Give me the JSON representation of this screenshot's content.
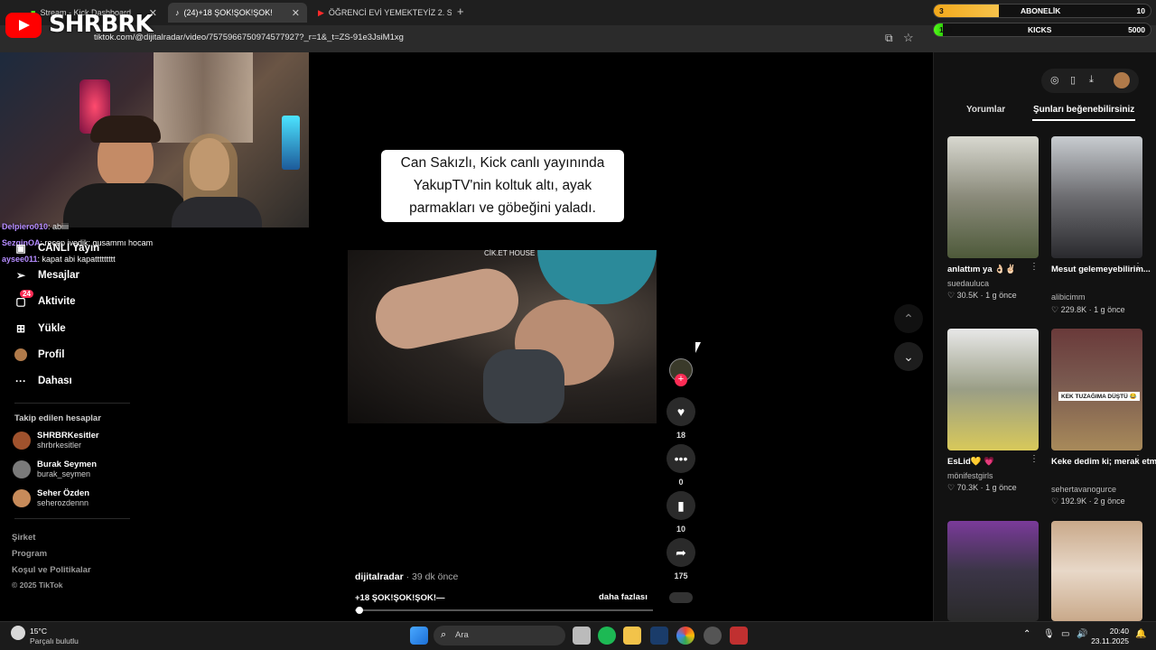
{
  "browser": {
    "tabs": [
      {
        "label": "Stream - Kick Dashboard"
      },
      {
        "label": "(24)+18 ŞOK!ŞOK!ŞOK!"
      },
      {
        "label": "ÖĞRENCİ EVİ YEMEKTEYİZ 2. S..."
      }
    ],
    "url": "tiktok.com/@dijitalradar/video/7575966750974577927?_r=1&_t=ZS-91e3JsiM1xg"
  },
  "overlay": {
    "channel": "SHRBRK",
    "subs": {
      "label": "ABONELİK",
      "current": "3",
      "goal": "10",
      "fraction": 0.3
    },
    "kicks": {
      "label": "KICKS",
      "current": "100",
      "goal": "5000",
      "fraction": 0.02
    }
  },
  "chat": [
    {
      "user": "Delpiero010",
      "text": ": abiiii"
    },
    {
      "user": "SezginOA",
      "text": ": recep ivedik: gusammı hocam"
    },
    {
      "user": "aysee011",
      "text": ": kapat abi kapattttttttt"
    }
  ],
  "sidebar": {
    "items": [
      {
        "label": "CANLI Yayın"
      },
      {
        "label": "Mesajlar"
      },
      {
        "label": "Aktivite",
        "badge": "24"
      },
      {
        "label": "Yükle"
      },
      {
        "label": "Profil"
      },
      {
        "label": "Dahası"
      }
    ],
    "following_title": "Takip edilen hesaplar",
    "following": [
      {
        "name": "SHRBRKesitler",
        "handle": "shrbrkesitler",
        "color": "#a0522d"
      },
      {
        "name": "Burak Seymen",
        "handle": "burak_seymen",
        "color": "#7a7a7a"
      },
      {
        "name": "Seher Özden",
        "handle": "seherozdennn",
        "color": "#c78b5a"
      }
    ],
    "footer": [
      "Şirket",
      "Program",
      "Koşul ve Politikalar",
      "© 2025 TikTok"
    ]
  },
  "video": {
    "caption_lines": [
      "Can Sakızlı, Kick canlı yayınında",
      "YakupTV'nin koltuk altı, ayak",
      "parmakları ve göbeğini yaladı."
    ],
    "tag": "CİK.ET HOUSE",
    "author": "dijitalradar",
    "time": " · 39 dk önce",
    "title": "+18 ŞOK!ŞOK!ŞOK!—",
    "more": "daha fazlası",
    "progress": 0.01,
    "counts": {
      "likes": "18",
      "comments": "0",
      "saves": "10",
      "shares": "175"
    }
  },
  "panel": {
    "tabs": [
      "Yorumlar",
      "Şunları beğenebilirsiniz"
    ],
    "videos": [
      {
        "title": "anlattım ya 👌🏻✌🏻",
        "user": "suedauluca",
        "meta": "♡ 30.5K · 1 g önce",
        "bg": "#8a8a7a"
      },
      {
        "title": "Mesut gelemeyebilirim...",
        "user": "alibicimm",
        "meta": "♡ 229.8K · 1 g önce",
        "bg": "#6c6c70"
      },
      {
        "title": "EsLid💛 💗",
        "user": "mönifestgirls",
        "meta": "♡ 70.3K · 1 g önce",
        "bg": "#9a9e86"
      },
      {
        "title": "Keke dedim ki; merak etme bug...",
        "user": "sehertavanogurce",
        "meta": "♡ 192.9K · 2 g önce",
        "bg": "#7a5a50",
        "label": "KEK TUZAĞIMA DÜŞTÜ 😂"
      },
      {
        "title": "",
        "user": "",
        "meta": "",
        "bg": "#3b3547"
      },
      {
        "title": "",
        "user": "",
        "meta": "",
        "bg": "#c9a98a"
      }
    ]
  },
  "taskbar": {
    "weather_temp": "15°C",
    "weather_desc": "Parçalı bulutlu",
    "search": "Ara",
    "time": "20:40",
    "date": "23.11.2025"
  }
}
